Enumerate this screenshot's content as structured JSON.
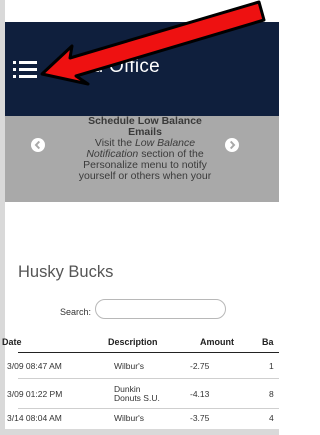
{
  "header": {
    "title": "Card Office",
    "title_visible": "ard Office",
    "menu_icon": "hamburger-menu-icon",
    "background": "#0f1f3d"
  },
  "banner": {
    "title_line1": "Schedule Low Balance",
    "title_line2": "Emails",
    "body_line1_prefix": "Visit the ",
    "body_line1_em": "Low Balance",
    "body_line2_em": "Notification",
    "body_line2_rest": " section of the",
    "body_line3": "Personalize menu to notify",
    "body_line4": "yourself or others when your",
    "prev_icon": "chevron-left-icon",
    "next_icon": "chevron-right-icon",
    "background": "#a9a9a9"
  },
  "husky_bucks": {
    "title": "Husky Bucks",
    "search_label": "Search:",
    "search_value": "",
    "columns": [
      "Date",
      "Description",
      "Amount",
      "Ba"
    ],
    "rows": [
      {
        "date": "3/09 08:47 AM",
        "description_line1": "Wilbur's",
        "description_line2": "",
        "amount": "-2.75",
        "balance": "1"
      },
      {
        "date": "3/09 01:22 PM",
        "description_line1": "Dunkin",
        "description_line2": "Donuts S.U.",
        "amount": "-4.13",
        "balance": "8"
      },
      {
        "date": "3/14 08:04 AM",
        "description_line1": "Wilbur's",
        "description_line2": "",
        "amount": "-3.75",
        "balance": "4"
      }
    ]
  },
  "annotation": {
    "arrow_icon": "red-arrow-icon",
    "arrow_color": "#ee1111"
  }
}
